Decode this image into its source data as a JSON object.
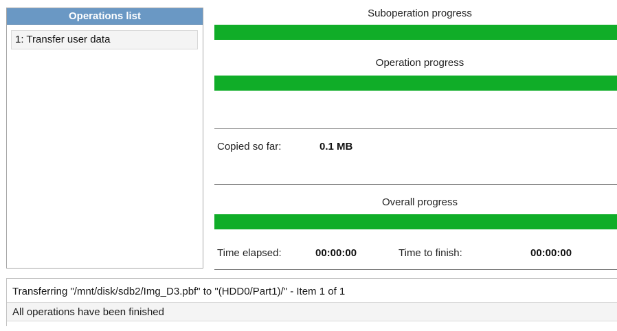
{
  "operations_list": {
    "header": "Operations list",
    "items": [
      {
        "label": "1: Transfer user data"
      }
    ]
  },
  "suboperation_progress": {
    "label": "Suboperation progress",
    "percent": 100
  },
  "operation_progress": {
    "label": "Operation progress",
    "percent": 100
  },
  "copied": {
    "label": "Copied so far:",
    "value": "0.1 MB"
  },
  "overall_progress": {
    "label": "Overall progress",
    "percent": 100
  },
  "time": {
    "elapsed_label": "Time elapsed:",
    "elapsed_value": "00:00:00",
    "finish_label": "Time to finish:",
    "finish_value": "00:00:00"
  },
  "log": {
    "lines": [
      "Transferring \"/mnt/disk/sdb2/Img_D3.pbf\" to \"(HDD0/Part1)/\" - Item 1 of 1",
      "All operations have been finished"
    ]
  },
  "colors": {
    "progress_fill": "#10ad28",
    "header_bg": "#6a98c4"
  }
}
